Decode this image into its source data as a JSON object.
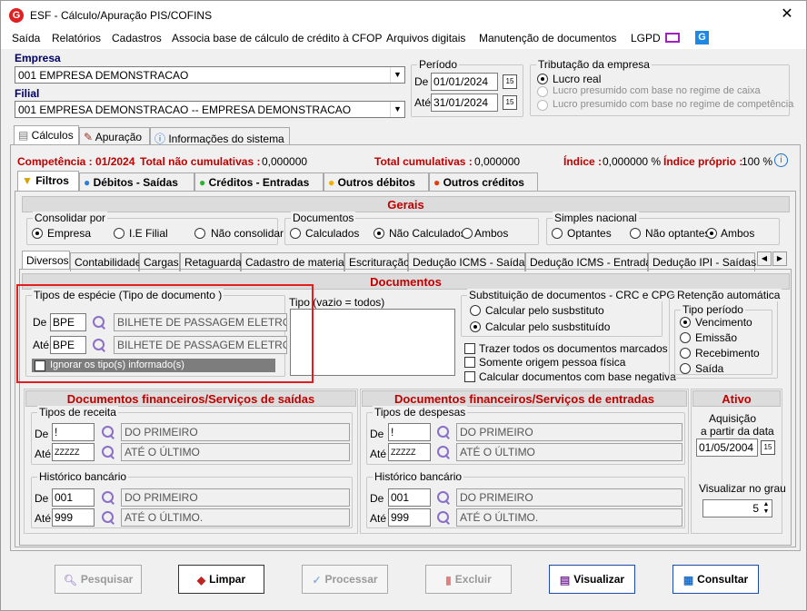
{
  "window": {
    "title": "ESF - Cálculo/Apuração PIS/COFINS",
    "logo": "G",
    "close": "✕"
  },
  "menu": [
    "Saída",
    "Relatórios",
    "Cadastros",
    "Associa base de cálculo de crédito à CFOP",
    "Arquivos digitais",
    "Manutenção de documentos",
    "LGPD"
  ],
  "empresa": {
    "label": "Empresa",
    "value": "001 EMPRESA DEMONSTRACAO"
  },
  "filial": {
    "label": "Filial",
    "value": "001 EMPRESA DEMONSTRACAO -- EMPRESA DEMONSTRACAO"
  },
  "periodo": {
    "title": "Período",
    "de_label": "De",
    "de": "01/01/2024",
    "ate_label": "Até",
    "ate": "31/01/2024"
  },
  "tributacao": {
    "title": "Tributação da empresa",
    "opt1": "Lucro real",
    "opt2": "Lucro presumido com base no regime de caixa",
    "opt3": "Lucro presumido com base no regime de competência"
  },
  "tabs_main": [
    "Cálculos",
    "Apuração",
    "Informações do sistema"
  ],
  "status": {
    "competencia": "Competência : 01/2024",
    "nao_cum_label": "Total não cumulativas :",
    "nao_cum": "0,000000",
    "cum_label": "Total cumulativas :",
    "cum": "0,000000",
    "indice_label": "Índice :",
    "indice": "0,000000 %",
    "indice_proprio_label": "Índice próprio :",
    "indice_proprio": "100 %"
  },
  "tabs_sub": [
    "Filtros",
    "Débitos - Saídas",
    "Créditos - Entradas",
    "Outros débitos",
    "Outros créditos"
  ],
  "gerais": {
    "title": "Gerais",
    "consolidar": {
      "title": "Consolidar por",
      "o1": "Empresa",
      "o2": "I.E Filial",
      "o3": "Não consolidar"
    },
    "documentos": {
      "title": "Documentos",
      "o1": "Calculados",
      "o2": "Não Calculados",
      "o3": "Ambos"
    },
    "simples": {
      "title": "Simples nacional",
      "o1": "Optantes",
      "o2": "Não optantes",
      "o3": "Ambos"
    }
  },
  "tabs_inner": [
    "Diversos",
    "Contabilidade",
    "Cargas",
    "Retaguarda",
    "Cadastro de materiais",
    "Escrituração",
    "Dedução ICMS - Saídas",
    "Dedução ICMS - Entradas",
    "Dedução IPI - Saídas"
  ],
  "docs": {
    "title": "Documentos",
    "tipos": {
      "title": "Tipos de espécie (Tipo de documento )",
      "de_label": "De",
      "de_code": "BPE",
      "de_desc": "BILHETE DE PASSAGEM ELETRONIC",
      "ate_label": "Até",
      "ate_code": "BPE",
      "ate_desc": "BILHETE DE PASSAGEM ELETRONIC",
      "ignorar": "Ignorar os tipo(s) informado(s)"
    },
    "tipo_label": "Tipo (vazio = todos)",
    "subst": {
      "title": "Substituição de documentos - CRC e CPG",
      "o1": "Calcular pelo susbstituto",
      "o2": "Calcular pelo susbstituído"
    },
    "c1": "Trazer todos os documentos marcados",
    "c2": "Somente origem pessoa física",
    "c3": "Calcular documentos com base negativa",
    "ret": {
      "title": "Retenção automática",
      "sub": "Tipo período",
      "o1": "Vencimento",
      "o2": "Emissão",
      "o3": "Recebimento",
      "o4": "Saída"
    }
  },
  "saidas": {
    "title": "Documentos financeiros/Serviços de saídas",
    "receita": {
      "title": "Tipos de receita",
      "de_label": "De",
      "de_code": "!",
      "de_desc": "DO PRIMEIRO",
      "ate_label": "Até",
      "ate_code": "ZZZZZ",
      "ate_desc": "ATÉ O ÚLTIMO"
    },
    "hist": {
      "title": "Histórico bancário",
      "de_label": "De",
      "de_code": "001",
      "de_desc": "DO PRIMEIRO",
      "ate_label": "Até",
      "ate_code": "999",
      "ate_desc": "ATÉ O ÚLTIMO."
    }
  },
  "entradas": {
    "title": "Documentos financeiros/Serviços de entradas",
    "despesas": {
      "title": "Tipos de despesas",
      "de_label": "De",
      "de_code": "!",
      "de_desc": "DO PRIMEIRO",
      "ate_label": "Até",
      "ate_code": "ZZZZZ",
      "ate_desc": "ATÉ O ÚLTIMO"
    },
    "hist": {
      "title": "Histórico bancário",
      "de_label": "De",
      "de_code": "001",
      "de_desc": "DO PRIMEIRO",
      "ate_label": "Até",
      "ate_code": "999",
      "ate_desc": "ATÉ O ÚLTIMO."
    }
  },
  "ativo": {
    "title": "Ativo",
    "aq1": "Aquisição",
    "aq2": "a partir da data",
    "data": "01/05/2004",
    "grau_label": "Visualizar no grau",
    "grau": "5"
  },
  "buttons": {
    "pesquisar": "Pesquisar",
    "limpar": "Limpar",
    "processar": "Processar",
    "excluir": "Excluir",
    "visualizar": "Visualizar",
    "consultar": "Consultar"
  },
  "colors": {
    "accent_red": "#c00000",
    "highlight": "#e02020"
  }
}
